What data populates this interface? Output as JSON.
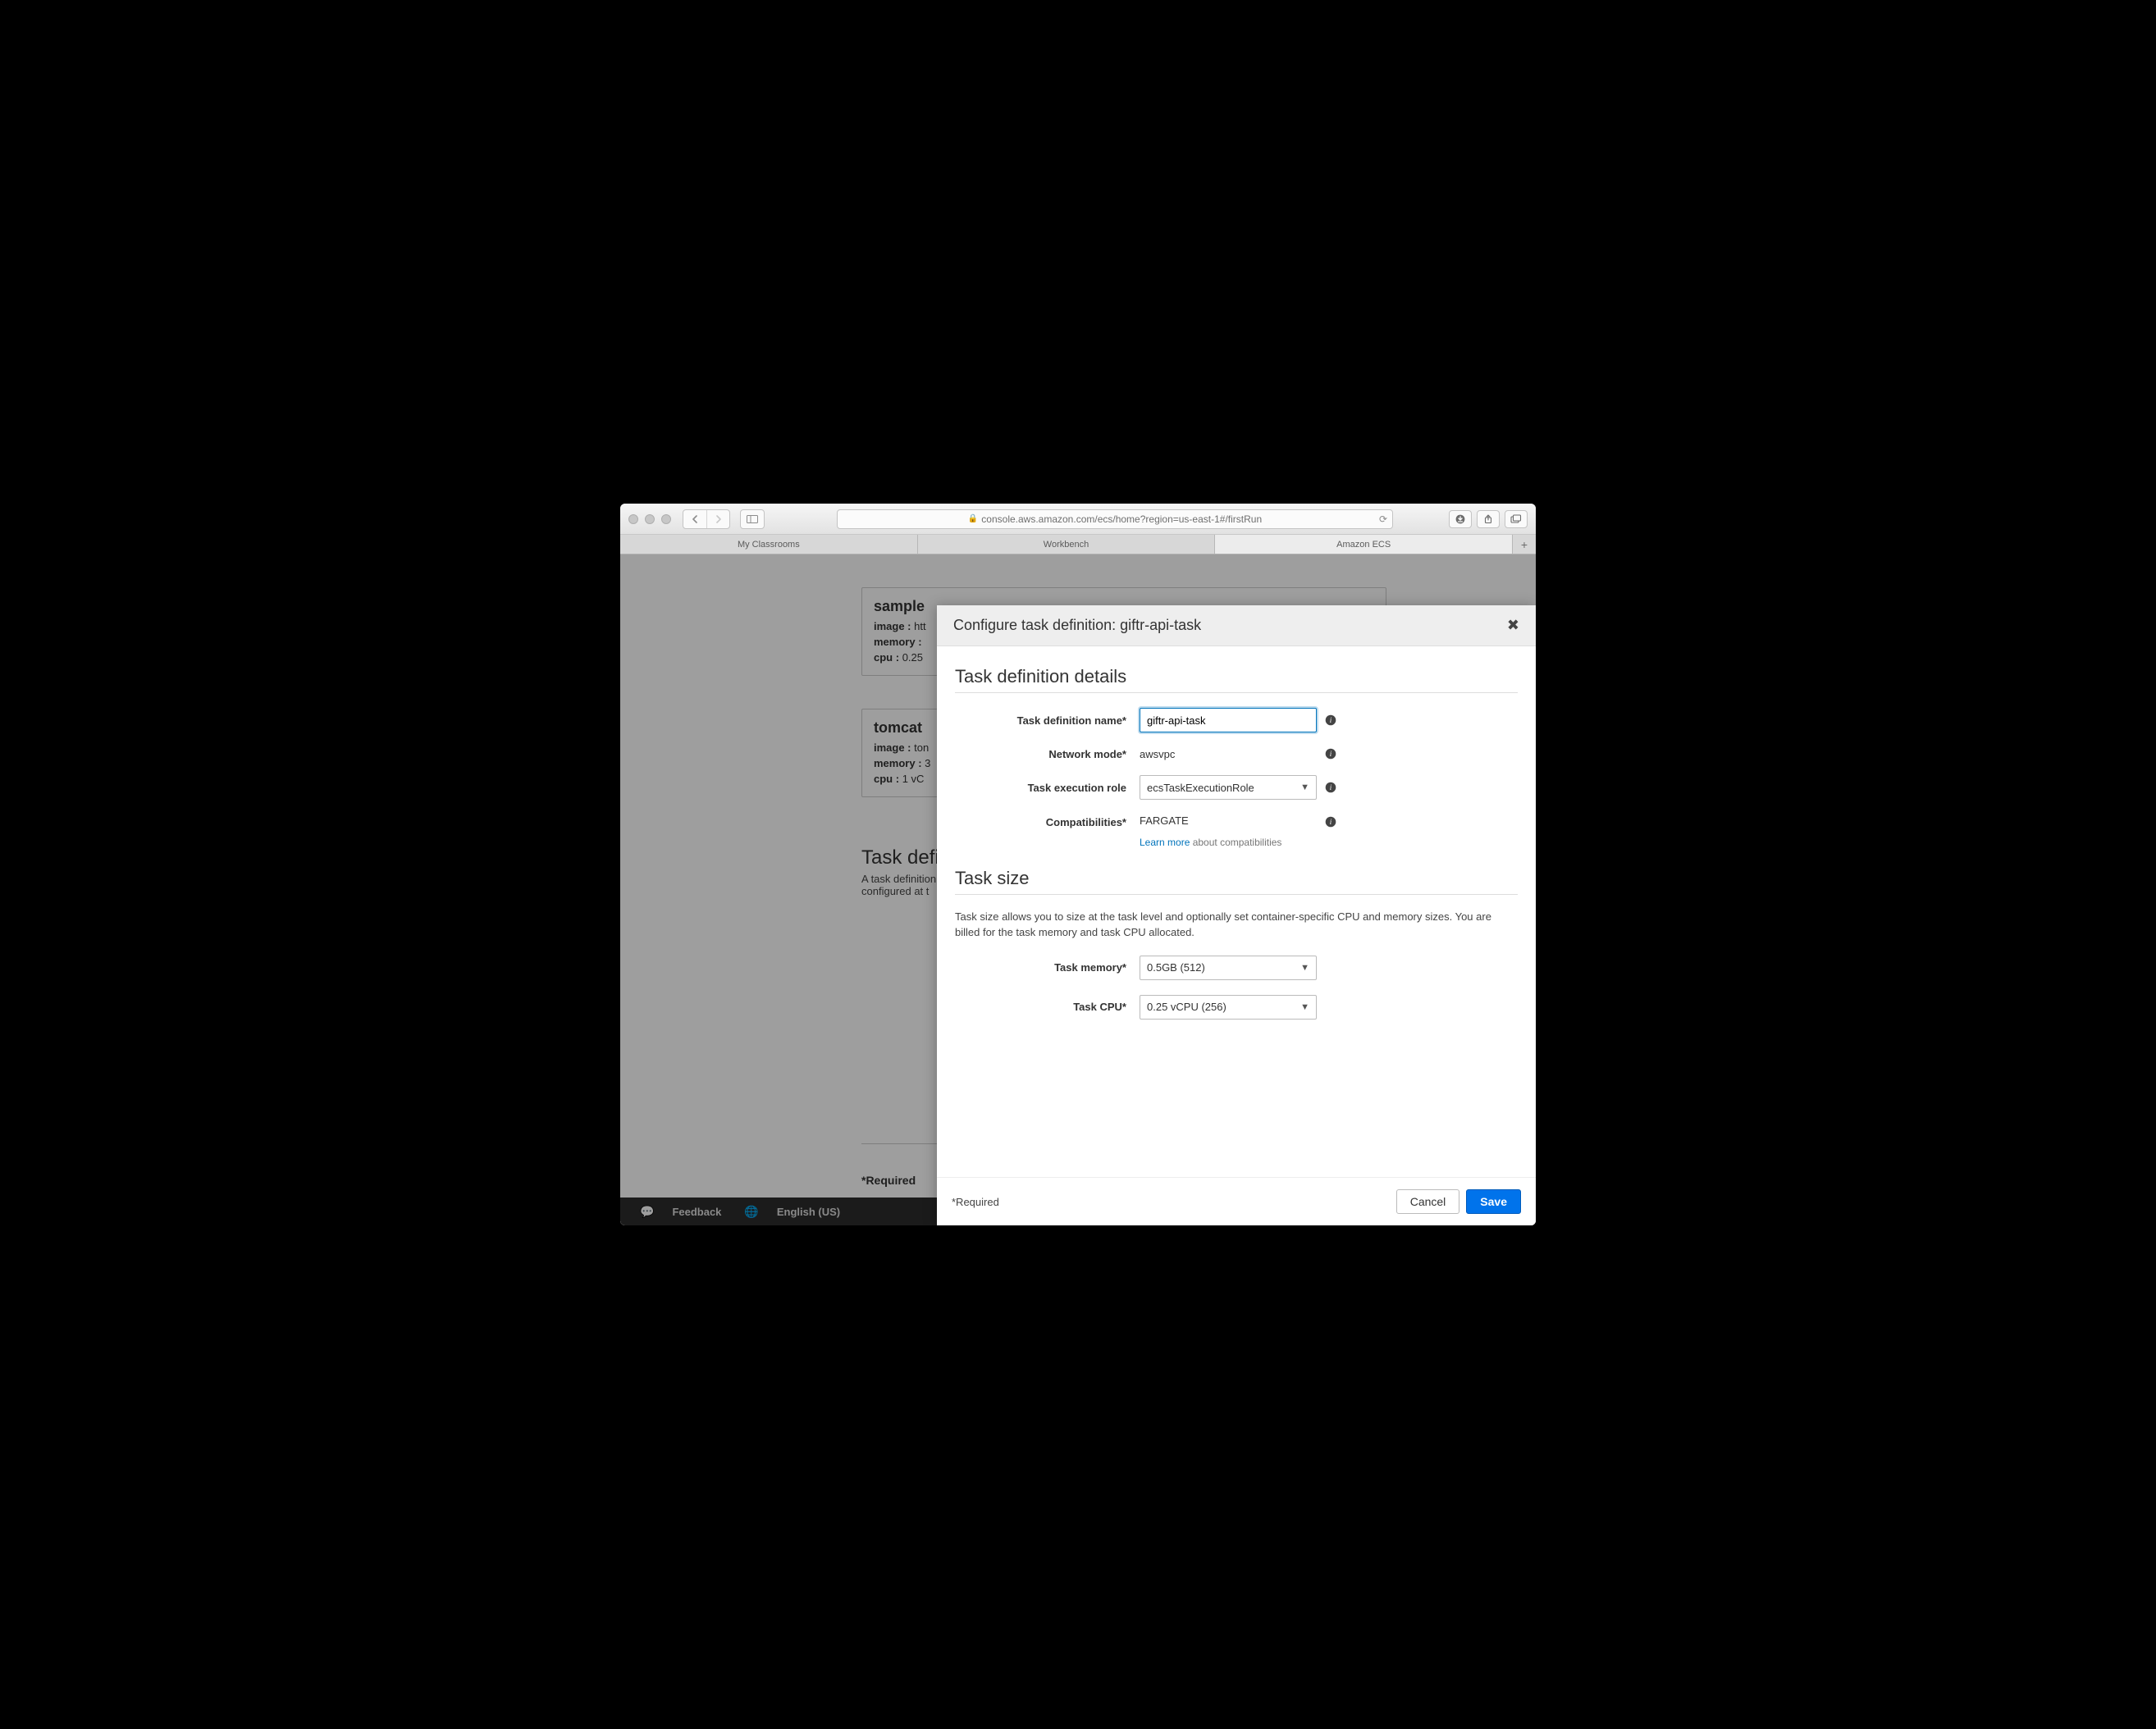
{
  "browser": {
    "url": "console.aws.amazon.com/ecs/home?region=us-east-1#/firstRun",
    "tabs": [
      "My Classrooms",
      "Workbench",
      "Amazon ECS"
    ],
    "active_tab_index": 2
  },
  "background": {
    "cards": [
      {
        "title": "sample",
        "image_label": "image :",
        "image_value": "htt",
        "memory_label": "memory :",
        "memory_value": "",
        "cpu_label": "cpu :",
        "cpu_value": "0.25"
      },
      {
        "title": "tomcat",
        "image_label": "image :",
        "image_value": "ton",
        "memory_label": "memory :",
        "memory_value": "3",
        "cpu_label": "cpu :",
        "cpu_value": "1 vC"
      }
    ],
    "section_title": "Task defi",
    "section_p1": "A task definition",
    "section_p2": "configured at t",
    "required_label": "*Required",
    "footer": {
      "feedback": "Feedback",
      "language": "English (US)"
    }
  },
  "modal": {
    "title": "Configure task definition: giftr-api-task",
    "sections": {
      "details_title": "Task definition details",
      "size_title": "Task size",
      "size_desc": "Task size allows you to size at the task level and optionally set container-specific CPU and memory sizes. You are billed for the task memory and task CPU allocated."
    },
    "fields": {
      "name_label": "Task definition name*",
      "name_value": "giftr-api-task",
      "network_label": "Network mode*",
      "network_value": "awsvpc",
      "role_label": "Task execution role",
      "role_value": "ecsTaskExecutionRole",
      "compat_label": "Compatibilities*",
      "compat_value": "FARGATE",
      "compat_learn": "Learn more",
      "compat_about": " about compatibilities",
      "memory_label": "Task memory*",
      "memory_value": "0.5GB (512)",
      "cpu_label": "Task CPU*",
      "cpu_value": "0.25 vCPU (256)"
    },
    "footer": {
      "required": "*Required",
      "cancel": "Cancel",
      "save": "Save"
    }
  }
}
